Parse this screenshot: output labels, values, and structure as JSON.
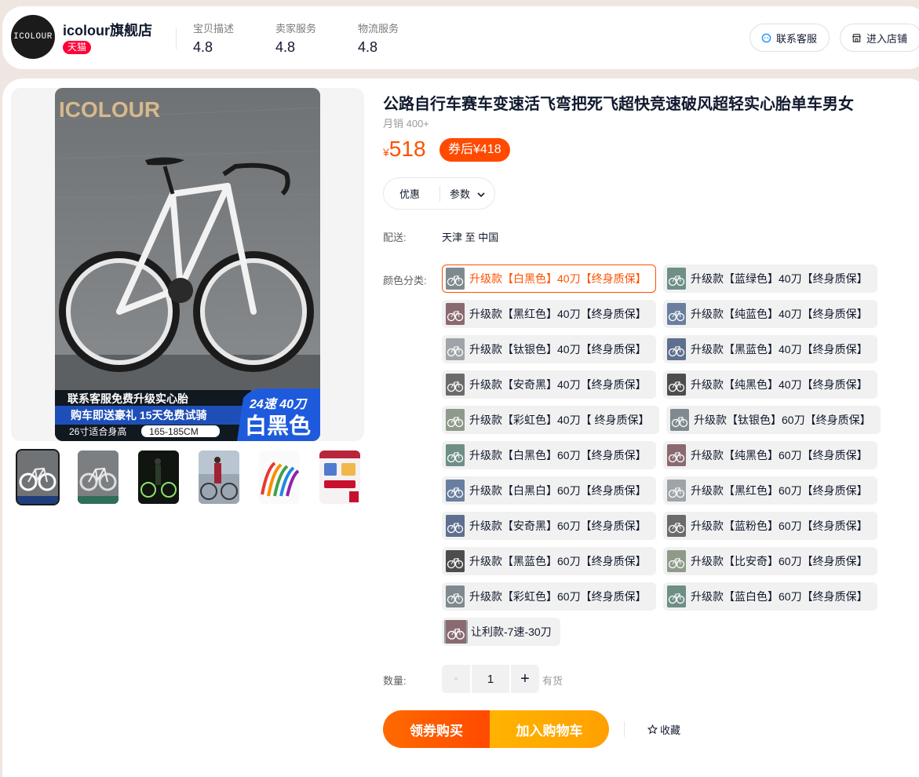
{
  "shop": {
    "logo_text": "ICOLOUR",
    "name": "icolour旗舰店",
    "badge": "天猫",
    "ratings": [
      {
        "label": "宝贝描述",
        "value": "4.8"
      },
      {
        "label": "卖家服务",
        "value": "4.8"
      },
      {
        "label": "物流服务",
        "value": "4.8"
      }
    ],
    "contact_label": "联系客服",
    "enter_shop_label": "进入店铺"
  },
  "gallery": {
    "brand_watermark": "ICOLOUR",
    "banner_line1": "联系客服免费升级实心胎",
    "banner_line2": "购车即送豪礼 15天免费试骑",
    "banner_line3": "26寸适合身高",
    "height_range": "165-185CM",
    "spec_speed": "24速 40刀",
    "spec_color": "白黑色",
    "thumbnail_count": 6
  },
  "product": {
    "title": "公路自行车赛车变速活飞弯把死飞超快竞速破风超轻实心胎单车男女",
    "monthly_sales": "月销 400+",
    "currency": "¥",
    "price": "518",
    "coupon_price": "券后¥418",
    "tab_offer": "优惠",
    "tab_params": "参数"
  },
  "delivery": {
    "label": "配送:",
    "route": "天津 至 中国"
  },
  "sku": {
    "label": "颜色分类:",
    "selected_index": 0,
    "options": [
      "升级款【白黑色】40刀【终身质保】",
      "升级款【蓝绿色】40刀【终身质保】",
      "升级款【黑红色】40刀【终身质保】",
      "升级款【纯蓝色】40刀【终身质保】",
      "升级款【钛银色】40刀【终身质保】",
      "升级款【黑蓝色】40刀【终身质保】",
      "升级款【安奇黑】40刀【终身质保】",
      "升级款【纯黑色】40刀【终身质保】",
      "升级款【彩虹色】40刀【 终身质保】",
      "升级款【钛银色】60刀【终身质保】",
      "升级款【白黑色】60刀【终身质保】",
      "升级款【纯黑色】60刀【终身质保】",
      "升级款【白黑白】60刀【终身质保】",
      "升级款【黑红色】60刀【终身质保】",
      "升级款【安奇黑】60刀【终身质保】",
      "升级款【蓝粉色】60刀【终身质保】",
      "升级款【黑蓝色】60刀【终身质保】",
      "升级款【比安奇】60刀【终身质保】",
      "升级款【彩虹色】60刀【终身质保】",
      "升级款【蓝白色】60刀【终身质保】",
      "让利款-7速-30刀"
    ]
  },
  "quantity": {
    "label": "数量:",
    "minus": "-",
    "value": "1",
    "plus": "+",
    "stock": "有货"
  },
  "actions": {
    "buy_now": "领券购买",
    "add_to_cart": "加入购物车",
    "favorite": "收藏"
  },
  "colors": {
    "accent": "#ff5000",
    "tmall": "#ff0036",
    "cart": "#ffa800"
  }
}
